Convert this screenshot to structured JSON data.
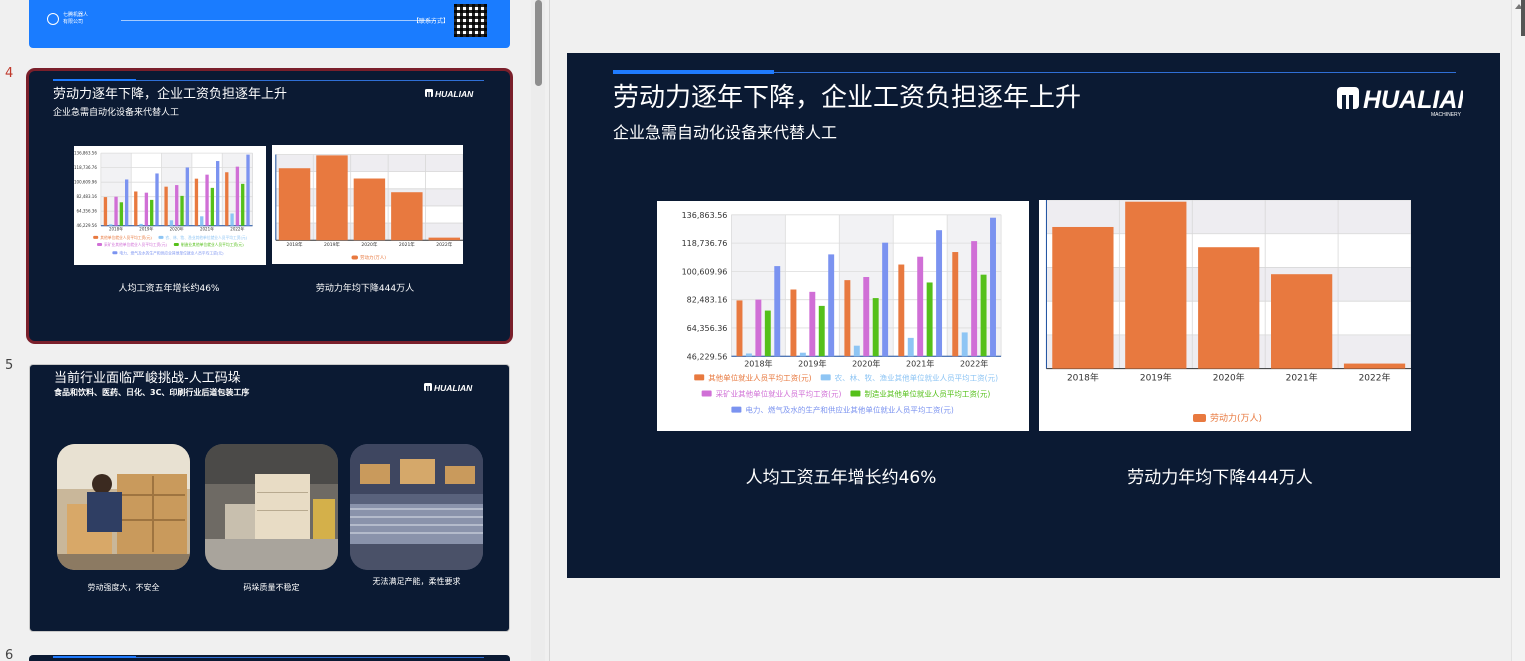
{
  "thumbnails": [
    {
      "number": "",
      "footer": {
        "brand_line1": "七腾机器人",
        "brand_line2": "有限公司",
        "contact": "【联系方式】"
      }
    },
    {
      "number": "4",
      "title": "劳动力逐年下降，企业工资负担逐年上升",
      "subtitle": "企业急需自动化设备来代替人工",
      "captions": [
        "人均工资五年增长约46%",
        "劳动力年均下降444万人"
      ]
    },
    {
      "number": "5",
      "title": "当前行业面临严峻挑战-人工码垛",
      "subtitle": "食品和饮料、医药、日化、3C、印刷行业后道包装工序",
      "captions": [
        "劳动强度大，不安全",
        "码垛质量不稳定",
        "无法满足产能，柔性要求"
      ]
    },
    {
      "number": "6"
    }
  ],
  "slide": {
    "title": "劳动力逐年下降，企业工资负担逐年上升",
    "subtitle": "企业急需自动化设备来代替人工",
    "captions": [
      "人均工资五年增长约46%",
      "劳动力年均下降444万人"
    ],
    "logo": {
      "name": "HUALIAN",
      "tagline": "MACHINERY",
      "icon": "hualian-logo-icon"
    }
  },
  "colors": {
    "slide_bg": "#0b1a33",
    "accent_blue": "#1f7bff",
    "orange": "#e8793f",
    "light_blue": "#8ec5f4",
    "purple": "#d06fd6",
    "green": "#55c01a",
    "blue": "#7b93f0"
  },
  "chart_data": [
    {
      "type": "bar",
      "categories": [
        "2018年",
        "2019年",
        "2020年",
        "2021年",
        "2022年"
      ],
      "ylim": [
        46229.56,
        136863.56
      ],
      "y_ticks": [
        "46,229.56",
        "64,356.36",
        "82,483.16",
        "100,609.96",
        "118,736.76",
        "136,863.56"
      ],
      "series": [
        {
          "name": "其他单位就业人员平均工资(元)",
          "color": "#e8793f",
          "values": [
            82000,
            89000,
            95000,
            105000,
            113000
          ]
        },
        {
          "name": "农、林、牧、渔业其他单位就业人员平均工资(元)",
          "color": "#8ec5f4",
          "values": [
            48000,
            48500,
            53000,
            58000,
            61500
          ]
        },
        {
          "name": "采矿业其他单位就业人员平均工资(元)",
          "color": "#d06fd6",
          "values": [
            82500,
            87500,
            97000,
            110000,
            120000
          ]
        },
        {
          "name": "制造业其他单位就业人员平均工资(元)",
          "color": "#55c01a",
          "values": [
            75500,
            78500,
            83500,
            93500,
            98500
          ]
        },
        {
          "name": "电力、燃气及水的生产和供应业其他单位就业人员平均工资(元)",
          "color": "#7b93f0",
          "values": [
            104000,
            111500,
            119000,
            127000,
            135000
          ]
        }
      ],
      "grid": true,
      "legend": "bottom"
    },
    {
      "type": "bar",
      "categories": [
        "2018年",
        "2019年",
        "2020年",
        "2021年",
        "2022年"
      ],
      "ylim": [
        0,
        100
      ],
      "series": [
        {
          "name": "劳动力(万人)",
          "color": "#e8793f",
          "values": [
            84,
            99,
            72,
            56,
            3
          ]
        }
      ],
      "grid": true,
      "legend": "bottom"
    }
  ]
}
